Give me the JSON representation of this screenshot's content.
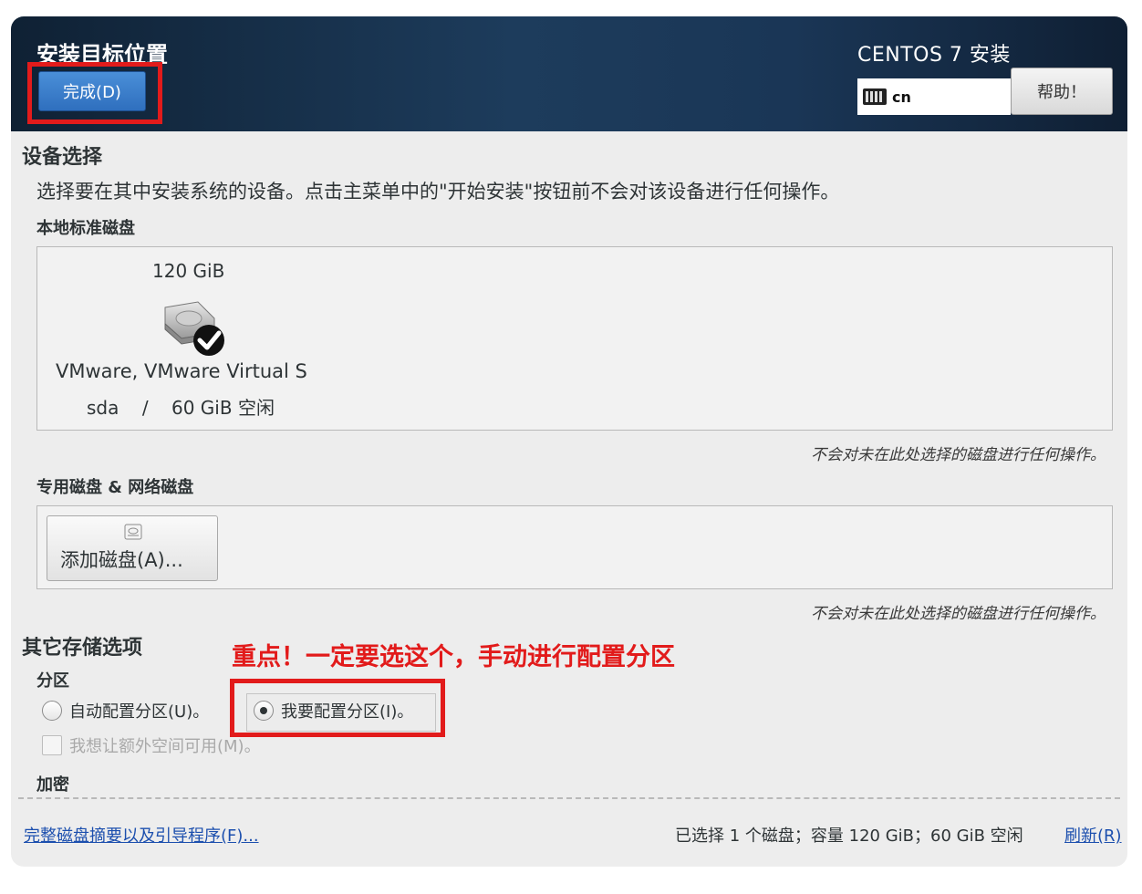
{
  "header": {
    "title": "安装目标位置",
    "done_label": "完成(D)",
    "product": "CENTOS 7 安装",
    "keyboard_layout": "cn",
    "help_label": "帮助！"
  },
  "device_selection": {
    "title": "设备选择",
    "description": "选择要在其中安装系统的设备。点击主菜单中的\"开始安装\"按钮前不会对该设备进行任何操作。",
    "local_disks_title": "本地标准磁盘",
    "disk": {
      "size": "120 GiB",
      "name": "VMware, VMware Virtual S",
      "device": "sda",
      "separator": "/",
      "free": "60 GiB 空闲"
    },
    "local_note": "不会对未在此处选择的磁盘进行任何操作。",
    "specialized_title": "专用磁盘 & 网络磁盘",
    "add_disk_label": "添加磁盘(A)...",
    "specialized_note": "不会对未在此处选择的磁盘进行任何操作。"
  },
  "other_storage": {
    "title": "其它存储选项",
    "annotation": "重点！一定要选这个，手动进行配置分区",
    "partition_title": "分区",
    "auto_label": "自动配置分区(U)。",
    "manual_label": "我要配置分区(I)。",
    "extra_space_label": "我想让额外空间可用(M)。",
    "encryption_title": "加密"
  },
  "footer": {
    "summary_link": "完整磁盘摘要以及引导程序(F)...",
    "summary_text": "已选择 1 个磁盘；容量 120 GiB；60 GiB 空闲",
    "refresh_link": "刷新(R)"
  },
  "colors": {
    "header_bg": "#1d3c5c",
    "done_button": "#2f6fbe",
    "annotation_red": "#e21b1b",
    "link_blue": "#1c4fae"
  }
}
